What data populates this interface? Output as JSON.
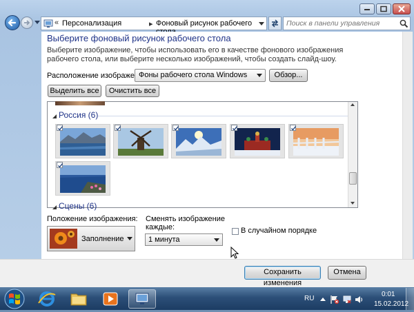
{
  "address_bar": {
    "chevron": "«",
    "crumbs": [
      "Персонализация",
      "Фоновый рисунок рабочего стола"
    ],
    "separator": "▸"
  },
  "search": {
    "placeholder": "Поиск в панели управления"
  },
  "main": {
    "heading": "Выберите фоновый рисунок рабочего стола",
    "description": "Выберите изображение, чтобы использовать его в качестве фонового изображения рабочего стола, или выберите несколько изображений, чтобы создать слайд-шоу.",
    "location_label": "Расположение изображения:",
    "location_value": "Фоны рабочего стола Windows",
    "browse_label": "Обзор...",
    "select_all_label": "Выделить все",
    "clear_all_label": "Очистить все"
  },
  "gallery": {
    "groups": [
      {
        "title": "Россия (6)",
        "images": [
          {
            "subject": "lake with mountains",
            "checked": true
          },
          {
            "subject": "windmill",
            "checked": true
          },
          {
            "subject": "snowy mountains with sun",
            "checked": true
          },
          {
            "subject": "cathedral in winter",
            "checked": true
          },
          {
            "subject": "frosty fence at sunset",
            "checked": true
          },
          {
            "subject": "coast with pink flowers",
            "checked": true
          }
        ]
      },
      {
        "title": "Сцены (6)"
      }
    ]
  },
  "position": {
    "label": "Положение изображения:",
    "value": "Заполнение"
  },
  "interval": {
    "label_line1": "Сменять изображение",
    "label_line2": "каждые:",
    "value": "1 минута"
  },
  "shuffle": {
    "label": "В случайном порядке",
    "checked": false
  },
  "footer": {
    "save_label": "Сохранить изменения",
    "cancel_label": "Отмена"
  },
  "taskbar": {
    "apps": [
      "internet-explorer",
      "windows-explorer",
      "media-player",
      "control-panel"
    ],
    "active_app": "control-panel",
    "language": "RU",
    "time": "0:01",
    "date": "15.02.2012"
  },
  "colors": {
    "accent_heading": "#1e3287",
    "taskbar": "#2c4f78",
    "window_frame": "#b8cfe8"
  }
}
